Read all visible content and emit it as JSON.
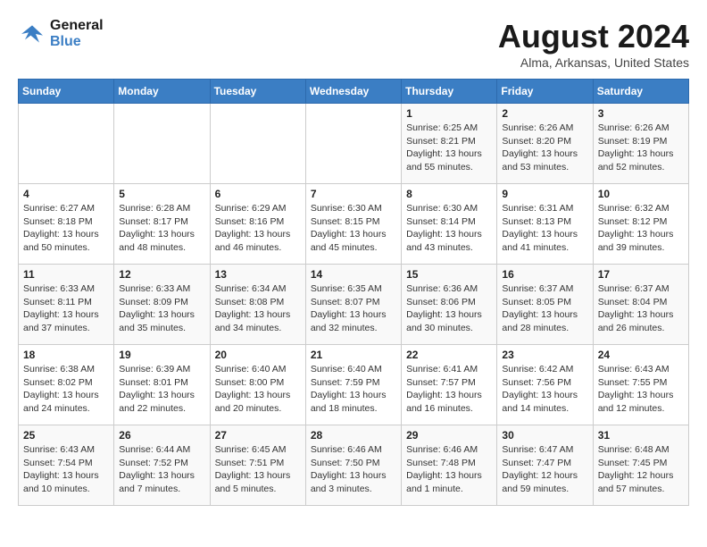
{
  "logo": {
    "text_general": "General",
    "text_blue": "Blue"
  },
  "header": {
    "title": "August 2024",
    "subtitle": "Alma, Arkansas, United States"
  },
  "days_of_week": [
    "Sunday",
    "Monday",
    "Tuesday",
    "Wednesday",
    "Thursday",
    "Friday",
    "Saturday"
  ],
  "weeks": [
    [
      {
        "day": "",
        "info": ""
      },
      {
        "day": "",
        "info": ""
      },
      {
        "day": "",
        "info": ""
      },
      {
        "day": "",
        "info": ""
      },
      {
        "day": "1",
        "info": "Sunrise: 6:25 AM\nSunset: 8:21 PM\nDaylight: 13 hours\nand 55 minutes."
      },
      {
        "day": "2",
        "info": "Sunrise: 6:26 AM\nSunset: 8:20 PM\nDaylight: 13 hours\nand 53 minutes."
      },
      {
        "day": "3",
        "info": "Sunrise: 6:26 AM\nSunset: 8:19 PM\nDaylight: 13 hours\nand 52 minutes."
      }
    ],
    [
      {
        "day": "4",
        "info": "Sunrise: 6:27 AM\nSunset: 8:18 PM\nDaylight: 13 hours\nand 50 minutes."
      },
      {
        "day": "5",
        "info": "Sunrise: 6:28 AM\nSunset: 8:17 PM\nDaylight: 13 hours\nand 48 minutes."
      },
      {
        "day": "6",
        "info": "Sunrise: 6:29 AM\nSunset: 8:16 PM\nDaylight: 13 hours\nand 46 minutes."
      },
      {
        "day": "7",
        "info": "Sunrise: 6:30 AM\nSunset: 8:15 PM\nDaylight: 13 hours\nand 45 minutes."
      },
      {
        "day": "8",
        "info": "Sunrise: 6:30 AM\nSunset: 8:14 PM\nDaylight: 13 hours\nand 43 minutes."
      },
      {
        "day": "9",
        "info": "Sunrise: 6:31 AM\nSunset: 8:13 PM\nDaylight: 13 hours\nand 41 minutes."
      },
      {
        "day": "10",
        "info": "Sunrise: 6:32 AM\nSunset: 8:12 PM\nDaylight: 13 hours\nand 39 minutes."
      }
    ],
    [
      {
        "day": "11",
        "info": "Sunrise: 6:33 AM\nSunset: 8:11 PM\nDaylight: 13 hours\nand 37 minutes."
      },
      {
        "day": "12",
        "info": "Sunrise: 6:33 AM\nSunset: 8:09 PM\nDaylight: 13 hours\nand 35 minutes."
      },
      {
        "day": "13",
        "info": "Sunrise: 6:34 AM\nSunset: 8:08 PM\nDaylight: 13 hours\nand 34 minutes."
      },
      {
        "day": "14",
        "info": "Sunrise: 6:35 AM\nSunset: 8:07 PM\nDaylight: 13 hours\nand 32 minutes."
      },
      {
        "day": "15",
        "info": "Sunrise: 6:36 AM\nSunset: 8:06 PM\nDaylight: 13 hours\nand 30 minutes."
      },
      {
        "day": "16",
        "info": "Sunrise: 6:37 AM\nSunset: 8:05 PM\nDaylight: 13 hours\nand 28 minutes."
      },
      {
        "day": "17",
        "info": "Sunrise: 6:37 AM\nSunset: 8:04 PM\nDaylight: 13 hours\nand 26 minutes."
      }
    ],
    [
      {
        "day": "18",
        "info": "Sunrise: 6:38 AM\nSunset: 8:02 PM\nDaylight: 13 hours\nand 24 minutes."
      },
      {
        "day": "19",
        "info": "Sunrise: 6:39 AM\nSunset: 8:01 PM\nDaylight: 13 hours\nand 22 minutes."
      },
      {
        "day": "20",
        "info": "Sunrise: 6:40 AM\nSunset: 8:00 PM\nDaylight: 13 hours\nand 20 minutes."
      },
      {
        "day": "21",
        "info": "Sunrise: 6:40 AM\nSunset: 7:59 PM\nDaylight: 13 hours\nand 18 minutes."
      },
      {
        "day": "22",
        "info": "Sunrise: 6:41 AM\nSunset: 7:57 PM\nDaylight: 13 hours\nand 16 minutes."
      },
      {
        "day": "23",
        "info": "Sunrise: 6:42 AM\nSunset: 7:56 PM\nDaylight: 13 hours\nand 14 minutes."
      },
      {
        "day": "24",
        "info": "Sunrise: 6:43 AM\nSunset: 7:55 PM\nDaylight: 13 hours\nand 12 minutes."
      }
    ],
    [
      {
        "day": "25",
        "info": "Sunrise: 6:43 AM\nSunset: 7:54 PM\nDaylight: 13 hours\nand 10 minutes."
      },
      {
        "day": "26",
        "info": "Sunrise: 6:44 AM\nSunset: 7:52 PM\nDaylight: 13 hours\nand 7 minutes."
      },
      {
        "day": "27",
        "info": "Sunrise: 6:45 AM\nSunset: 7:51 PM\nDaylight: 13 hours\nand 5 minutes."
      },
      {
        "day": "28",
        "info": "Sunrise: 6:46 AM\nSunset: 7:50 PM\nDaylight: 13 hours\nand 3 minutes."
      },
      {
        "day": "29",
        "info": "Sunrise: 6:46 AM\nSunset: 7:48 PM\nDaylight: 13 hours\nand 1 minute."
      },
      {
        "day": "30",
        "info": "Sunrise: 6:47 AM\nSunset: 7:47 PM\nDaylight: 12 hours\nand 59 minutes."
      },
      {
        "day": "31",
        "info": "Sunrise: 6:48 AM\nSunset: 7:45 PM\nDaylight: 12 hours\nand 57 minutes."
      }
    ]
  ]
}
